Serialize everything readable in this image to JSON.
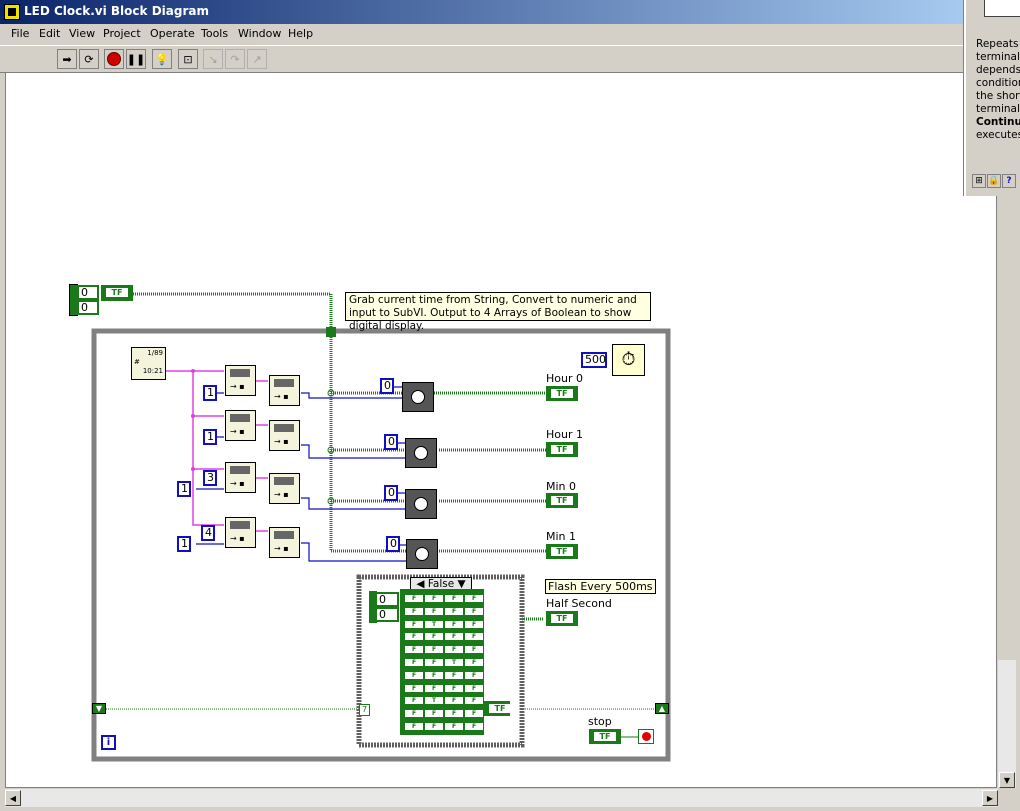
{
  "window": {
    "title": "LED Clock.vi Block Diagram"
  },
  "menu": [
    "File",
    "Edit",
    "View",
    "Project",
    "Operate",
    "Tools",
    "Window",
    "Help"
  ],
  "toolbar": {
    "buttons": [
      "run-arrow-icon",
      "run-continuously-icon",
      "abort-icon",
      "pause-icon",
      "highlight-execution-icon",
      "retain-wire-values-icon",
      "step-into-icon",
      "step-over-icon",
      "step-out-icon"
    ]
  },
  "help": {
    "lines": [
      "Repeats t",
      "terminal,",
      "depends",
      "condition",
      "the short",
      "terminal,",
      "Continu",
      "executes"
    ],
    "bold_line_index": 6
  },
  "diagram": {
    "comment": "Grab current time from String, Convert to numeric and input to SubVI. Output to 4 Arrays of Boolean to show digital display.",
    "array_control": {
      "index0": "0",
      "index1": "0",
      "element": "TF"
    },
    "format_string": {
      "top": "1/89",
      "bottom": "10:21"
    },
    "wait_ms": "500",
    "split_offsets": [
      "1",
      "1",
      "3",
      "4"
    ],
    "split_lengths": [
      "1",
      "1",
      "1",
      "1"
    ],
    "clock_consts": [
      "0",
      "0",
      "0",
      "0"
    ],
    "indicators": [
      {
        "label": "Hour 0",
        "value": "TF"
      },
      {
        "label": "Hour 1",
        "value": "TF"
      },
      {
        "label": "Min 0",
        "value": "TF"
      },
      {
        "label": "Min 1",
        "value": "TF"
      }
    ],
    "case_structure": {
      "selector": "False",
      "index0": "0",
      "index1": "0",
      "cell": "F",
      "cell_alt": "T"
    },
    "flash_note": "Flash Every 500ms",
    "half_second": {
      "label": "Half Second",
      "value": "TF"
    },
    "stop": {
      "label": "stop",
      "value": "TF"
    },
    "loop_const": "TF",
    "iteration": "i",
    "tunnel_num": "7"
  },
  "colors": {
    "wire_boolean": "#1a7a1a",
    "wire_string": "#e040e0",
    "wire_numeric": "#1010c0",
    "loop_border": "#808080",
    "comment_bg": "#ffffe1"
  }
}
